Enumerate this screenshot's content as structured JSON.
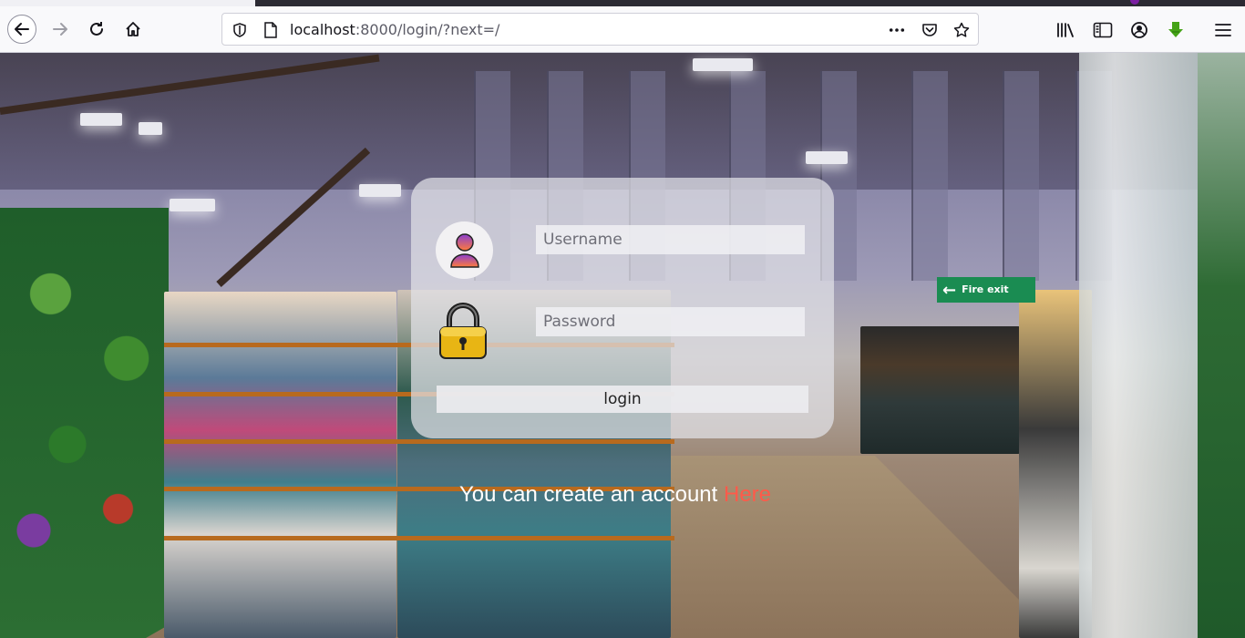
{
  "browser": {
    "url_host": "localhost",
    "url_path": ":8000/login/?next=/",
    "icons": {
      "back": "arrow-left-icon",
      "forward": "arrow-right-icon",
      "reload": "reload-icon",
      "home": "home-icon",
      "shield": "tracking-shield-icon",
      "page": "page-info-icon",
      "more": "ellipsis-icon",
      "pocket": "pocket-icon",
      "bookmark": "star-icon",
      "library": "library-icon",
      "sidebar": "sidebar-icon",
      "account": "account-icon",
      "download": "download-arrow-icon",
      "menu": "hamburger-menu-icon"
    },
    "download_color": "#45a317"
  },
  "login": {
    "username_placeholder": "Username",
    "password_placeholder": "Password",
    "login_label": "login",
    "user_icon": "user-avatar-icon",
    "lock_icon": "padlock-icon"
  },
  "signup": {
    "text": "You can create an account ",
    "link_text": "Here",
    "link_color": "#ff5a4a"
  },
  "background": {
    "exit_sign_text": "Fire exit"
  }
}
